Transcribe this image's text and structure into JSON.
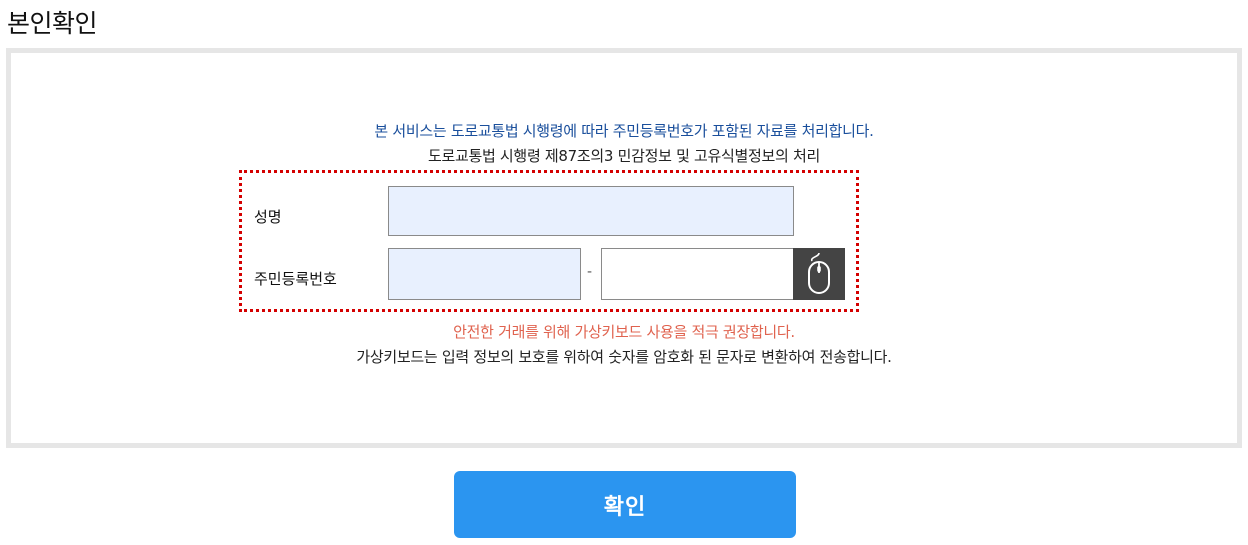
{
  "page": {
    "title": "본인확인"
  },
  "notice": {
    "line1": "본 서비스는 도로교통법 시행령에 따라 주민등록번호가 포함된 자료를 처리합니다.",
    "line2": "도로교통법 시행령 제87조의3 민감정보 및 고유식별정보의 처리"
  },
  "form": {
    "name_label": "성명",
    "name_value": "",
    "rrn_label": "주민등록번호",
    "rrn_front_value": "",
    "rrn_separator": "-",
    "rrn_back_value": "",
    "keypad_icon": "mouse-icon"
  },
  "security": {
    "warning": "안전한 거래를 위해 가상키보드 사용을 적극 권장합니다.",
    "info": "가상키보드는 입력 정보의 보호를 위하여 숫자를 암호화 된 문자로 변환하여 전송합니다."
  },
  "actions": {
    "confirm_label": "확인"
  },
  "colors": {
    "notice_blue": "#1a4f9c",
    "warning_red": "#e0634f",
    "button_blue": "#2b95f0",
    "dotted_border": "#d40000",
    "input_fill": "#e8f0fe",
    "keypad_bg": "#444444"
  }
}
